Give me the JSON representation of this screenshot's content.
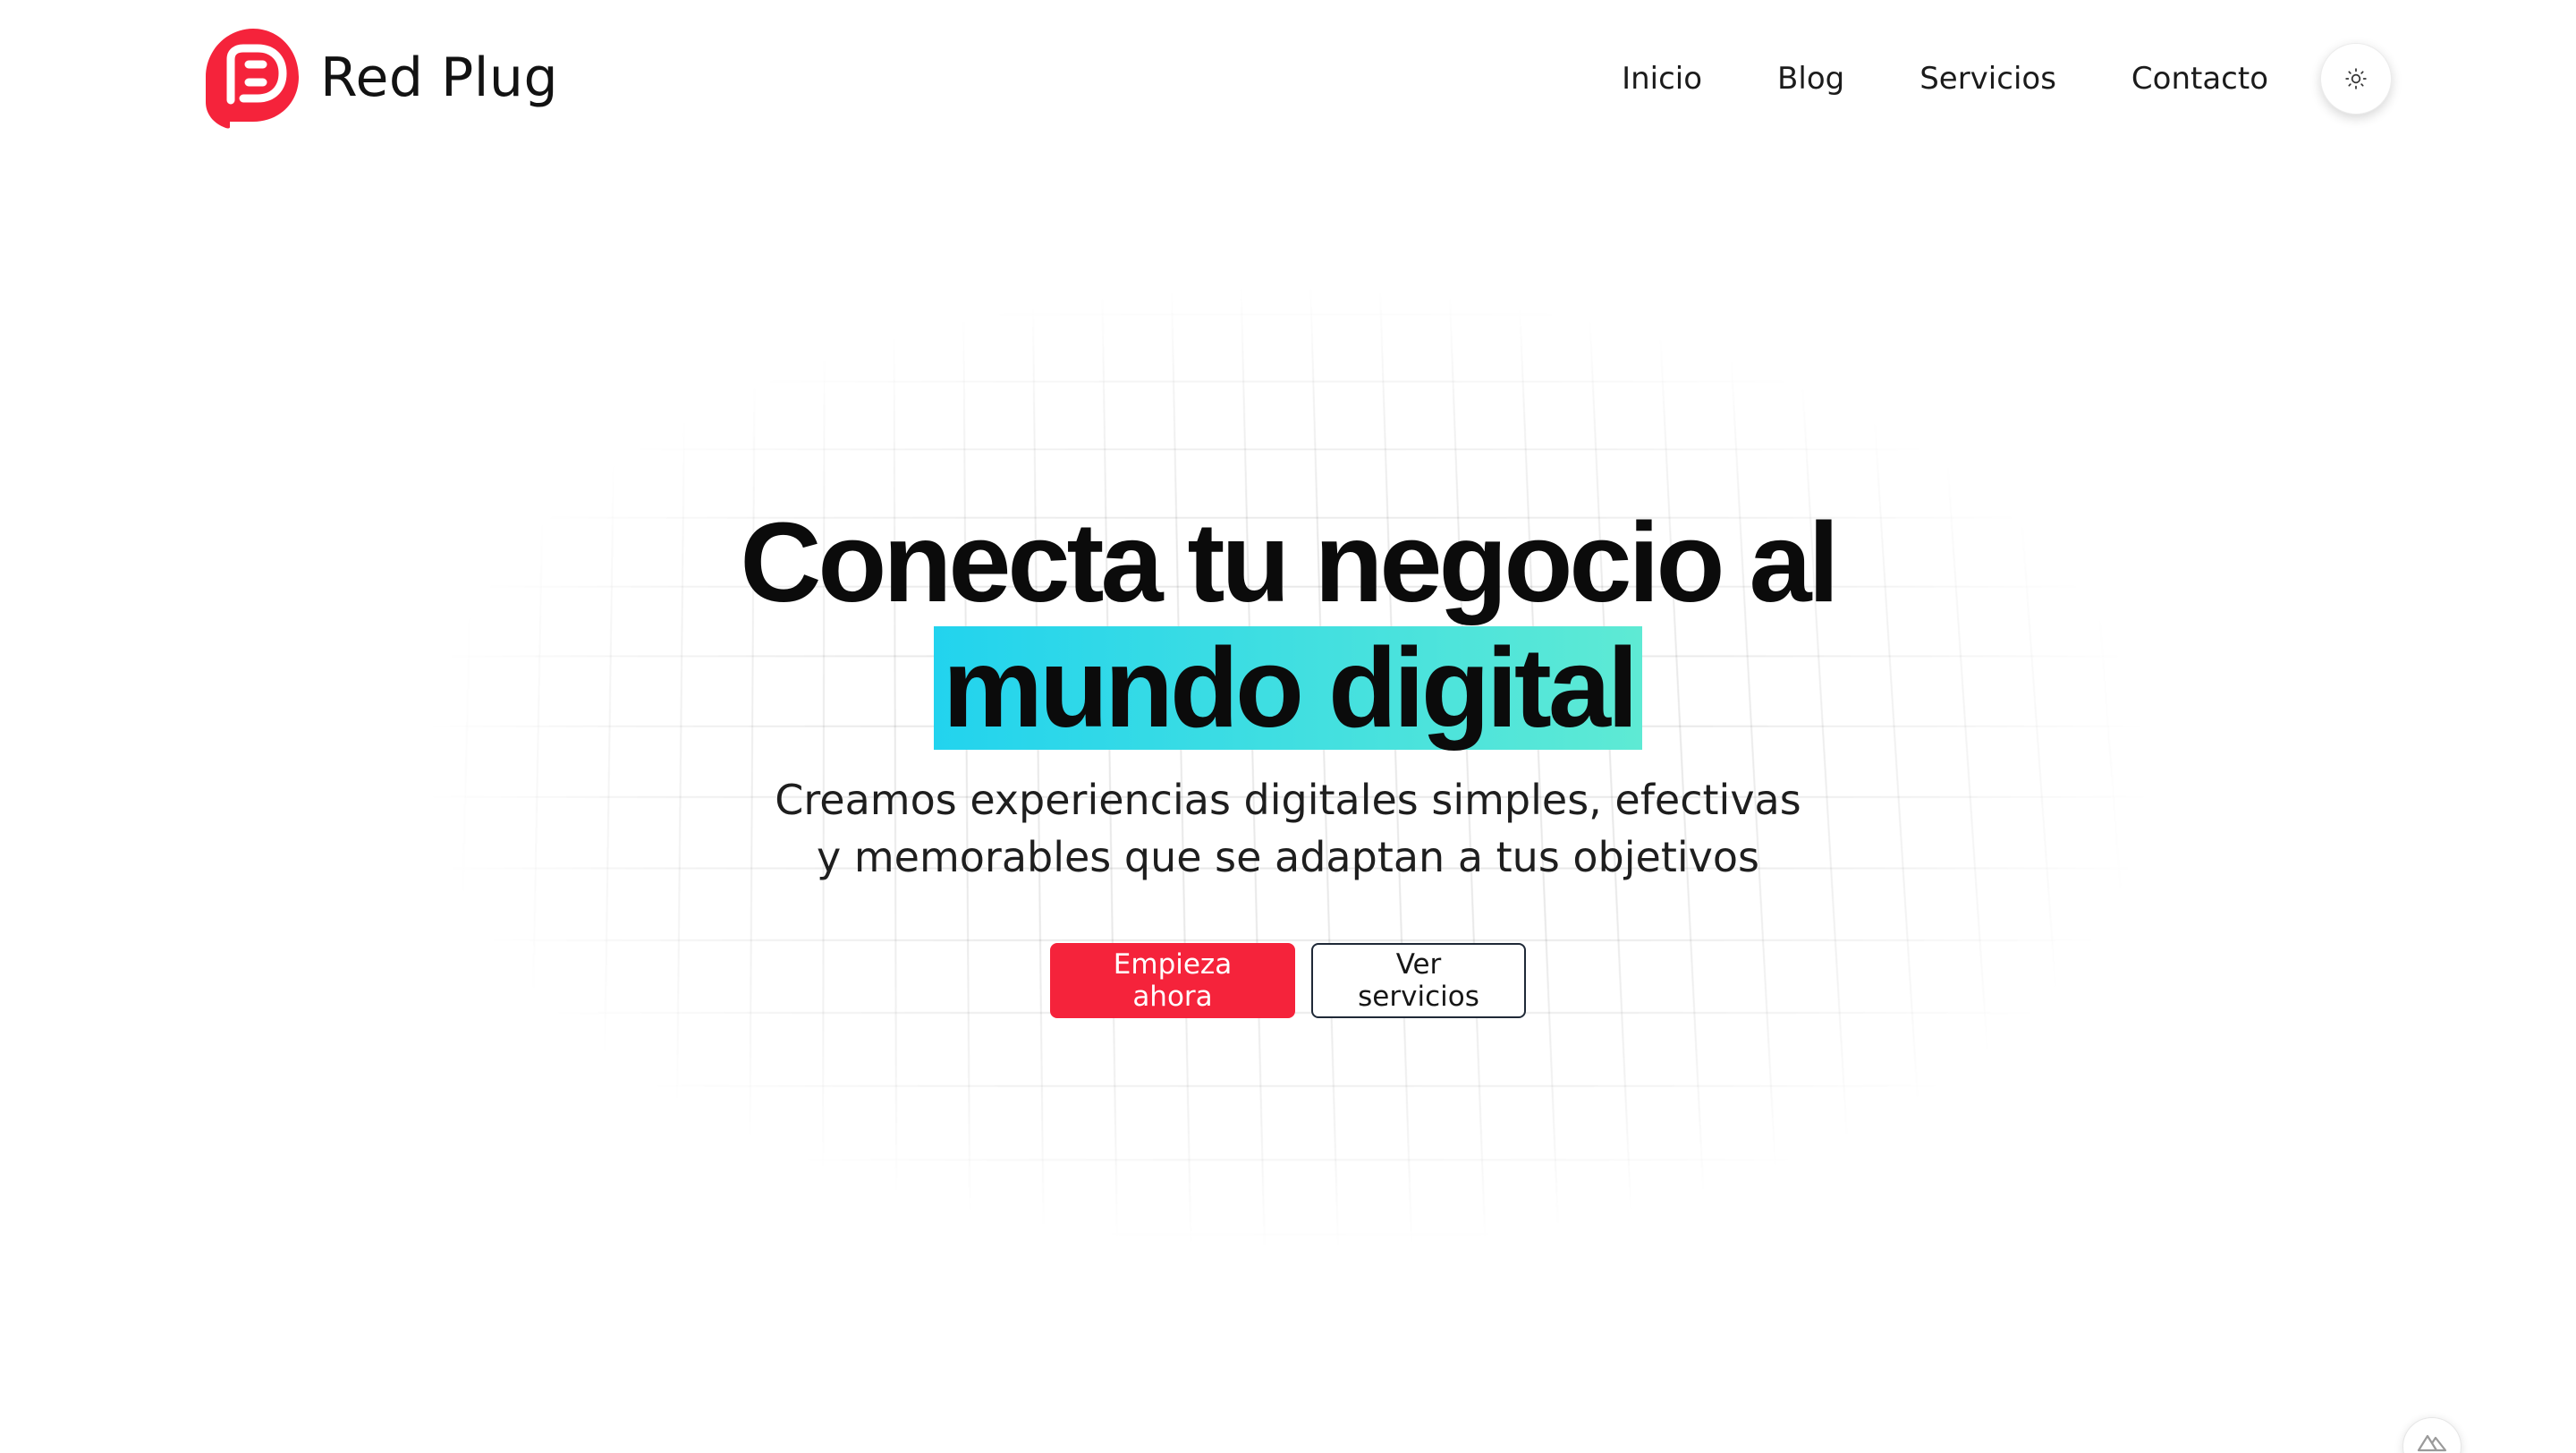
{
  "brand": {
    "name": "Red Plug",
    "logo_icon": "plug-logo-icon",
    "color": "#f5233b"
  },
  "nav": {
    "items": [
      {
        "label": "Inicio"
      },
      {
        "label": "Blog"
      },
      {
        "label": "Servicios"
      },
      {
        "label": "Contacto"
      }
    ],
    "theme_toggle_icon": "sun-icon"
  },
  "hero": {
    "title_line1": "Conecta tu negocio al",
    "title_highlight": "mundo digital",
    "highlight_gradient": [
      "#22d3ee",
      "#5eead4"
    ],
    "subtitle_line1": "Creamos experiencias digitales simples, efectivas",
    "subtitle_line2": "y memorables que se adaptan a tus objetivos",
    "primary_button": "Empieza ahora",
    "secondary_button": "Ver servicios"
  },
  "corner_widget": {
    "icon": "nuxt-devtools-icon"
  },
  "colors": {
    "accent": "#f5233b",
    "text": "#0b0b0b",
    "background": "#ffffff"
  }
}
